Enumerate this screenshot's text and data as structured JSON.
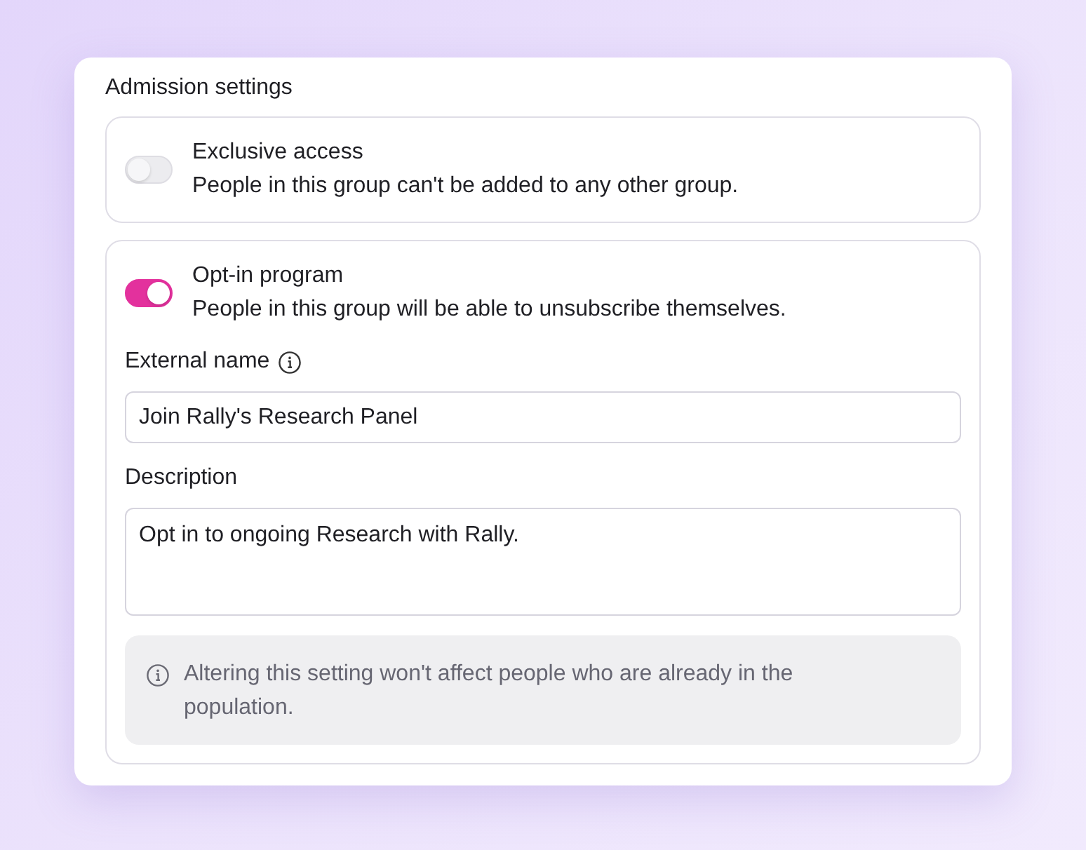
{
  "panel": {
    "title": "Admission settings"
  },
  "options": [
    {
      "title": "Exclusive access",
      "description": "People in this group can't be added to any other group.",
      "on": false
    },
    {
      "title": "Opt-in program",
      "description": "People in this group will be able to unsubscribe themselves.",
      "on": true,
      "fields": [
        {
          "kind": "input",
          "label": "External name",
          "info": true,
          "value": "Join Rally's Research Panel"
        },
        {
          "kind": "textarea",
          "label": "Description",
          "info": false,
          "value": "Opt in to ongoing Research with Rally."
        }
      ],
      "note": "Altering this setting won't affect people who are already in the population."
    }
  ]
}
